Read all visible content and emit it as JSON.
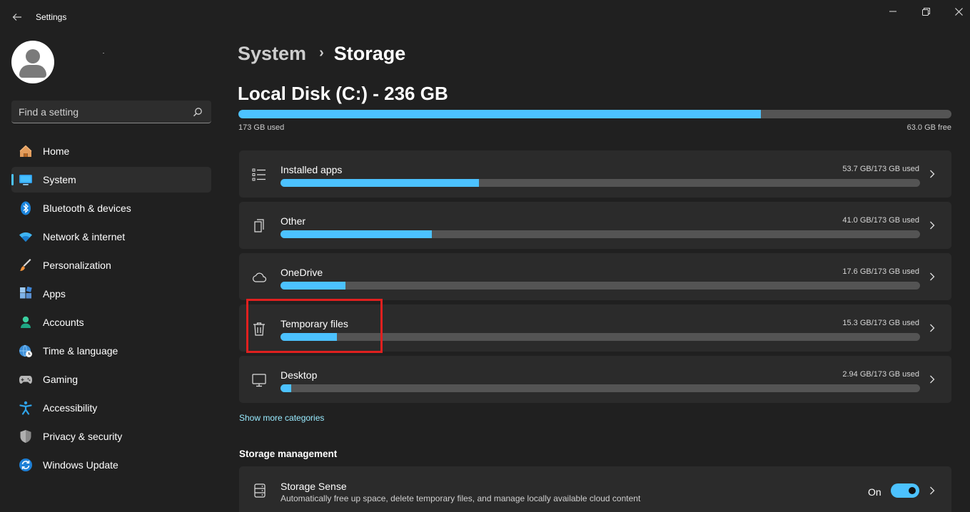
{
  "window": {
    "title": "Settings",
    "controls": {
      "minimize": "minimize-icon",
      "maximize": "maximize-icon",
      "close": "close-icon"
    }
  },
  "sidebar": {
    "search_placeholder": "Find a setting",
    "items": [
      {
        "label": "Home",
        "icon": "home-icon",
        "active": false
      },
      {
        "label": "System",
        "icon": "system-icon",
        "active": true
      },
      {
        "label": "Bluetooth & devices",
        "icon": "bluetooth-icon",
        "active": false
      },
      {
        "label": "Network & internet",
        "icon": "wifi-icon",
        "active": false
      },
      {
        "label": "Personalization",
        "icon": "brush-icon",
        "active": false
      },
      {
        "label": "Apps",
        "icon": "apps-icon",
        "active": false
      },
      {
        "label": "Accounts",
        "icon": "accounts-icon",
        "active": false
      },
      {
        "label": "Time & language",
        "icon": "globe-clock-icon",
        "active": false
      },
      {
        "label": "Gaming",
        "icon": "gamepad-icon",
        "active": false
      },
      {
        "label": "Accessibility",
        "icon": "accessibility-icon",
        "active": false
      },
      {
        "label": "Privacy & security",
        "icon": "shield-icon",
        "active": false
      },
      {
        "label": "Windows Update",
        "icon": "update-icon",
        "active": false
      }
    ]
  },
  "main": {
    "breadcrumb": {
      "parent": "System",
      "separator": "›",
      "current": "Storage"
    },
    "disk": {
      "title": "Local Disk (C:) - 236 GB",
      "used_label": "173 GB used",
      "free_label": "63.0 GB free",
      "used_fraction": 0.733
    },
    "categories": [
      {
        "label": "Installed apps",
        "usage": "53.7 GB/173 GB used",
        "fraction": 0.31,
        "icon": "list-icon"
      },
      {
        "label": "Other",
        "usage": "41.0 GB/173 GB used",
        "fraction": 0.237,
        "icon": "document-icon"
      },
      {
        "label": "OneDrive",
        "usage": "17.6 GB/173 GB used",
        "fraction": 0.102,
        "icon": "cloud-icon"
      },
      {
        "label": "Temporary files",
        "usage": "15.3 GB/173 GB used",
        "fraction": 0.088,
        "icon": "trash-icon"
      },
      {
        "label": "Desktop",
        "usage": "2.94 GB/173 GB used",
        "fraction": 0.017,
        "icon": "monitor-icon"
      }
    ],
    "show_more": "Show more categories",
    "storage_management": {
      "section_title": "Storage management",
      "storage_sense": {
        "title": "Storage Sense",
        "description": "Automatically free up space, delete temporary files, and manage locally available cloud content",
        "state_label": "On",
        "enabled": true
      }
    }
  },
  "colors": {
    "accent": "#4cc2ff",
    "background": "#202020",
    "card": "#2b2b2b",
    "highlight": "#e0201f"
  }
}
